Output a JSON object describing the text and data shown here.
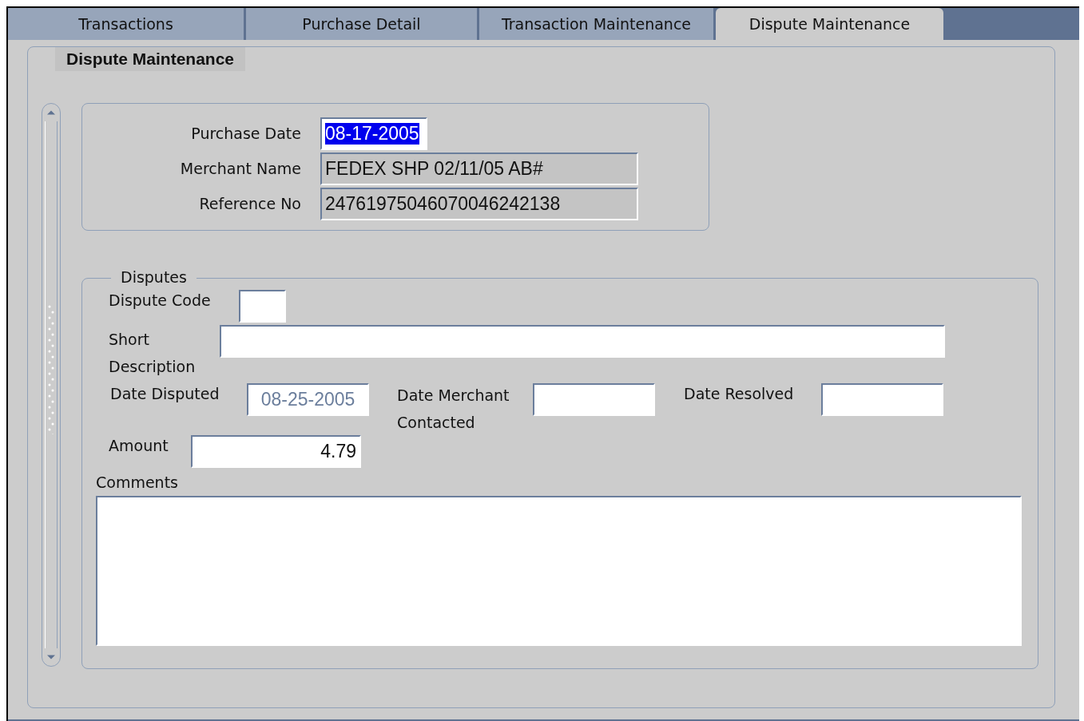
{
  "tabs": [
    {
      "label": "Transactions",
      "selected": false
    },
    {
      "label": "Purchase Detail",
      "selected": false
    },
    {
      "label": "Transaction Maintenance",
      "selected": false
    },
    {
      "label": "Dispute Maintenance",
      "selected": true
    }
  ],
  "section_title": "Dispute Maintenance",
  "purchase_fields": [
    {
      "label": "Purchase Date",
      "value": "08-17-2005",
      "highlighted": true,
      "readonly": false
    },
    {
      "label": "Merchant Name",
      "value": "FEDEX SHP 02/11/05 AB#",
      "highlighted": false,
      "readonly": true
    },
    {
      "label": "Reference No",
      "value": "24761975046070046242138",
      "highlighted": false,
      "readonly": true
    }
  ],
  "disputes": {
    "legend": "Disputes",
    "dispute_code": {
      "label": "Dispute Code"
    },
    "short_description": {
      "label": "Short Description"
    },
    "date_disputed": {
      "label": "Date Disputed",
      "value": "08-25-2005",
      "disabled": true
    },
    "date_merchant_contacted": {
      "label": "Date Merchant Contacted"
    },
    "date_resolved": {
      "label": "Date Resolved"
    },
    "amount": {
      "label": "Amount",
      "value": "4.79"
    },
    "comments": {
      "label": "Comments"
    }
  }
}
